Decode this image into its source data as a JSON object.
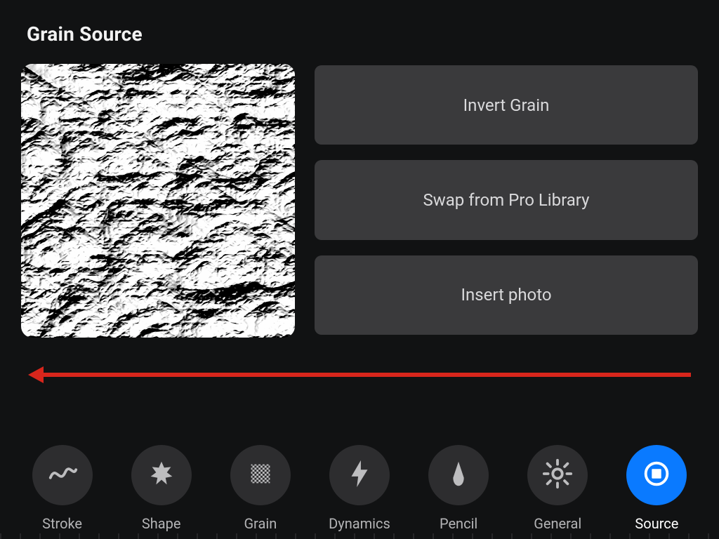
{
  "section": {
    "title": "Grain Source"
  },
  "actions": {
    "invert": "Invert Grain",
    "swap": "Swap from Pro Library",
    "insert": "Insert photo"
  },
  "tabs": {
    "stroke": "Stroke",
    "shape": "Shape",
    "grain": "Grain",
    "dynamics": "Dynamics",
    "pencil": "Pencil",
    "general": "General",
    "source": "Source"
  },
  "active_tab": "source",
  "annotation": {
    "color": "#d8261c"
  }
}
